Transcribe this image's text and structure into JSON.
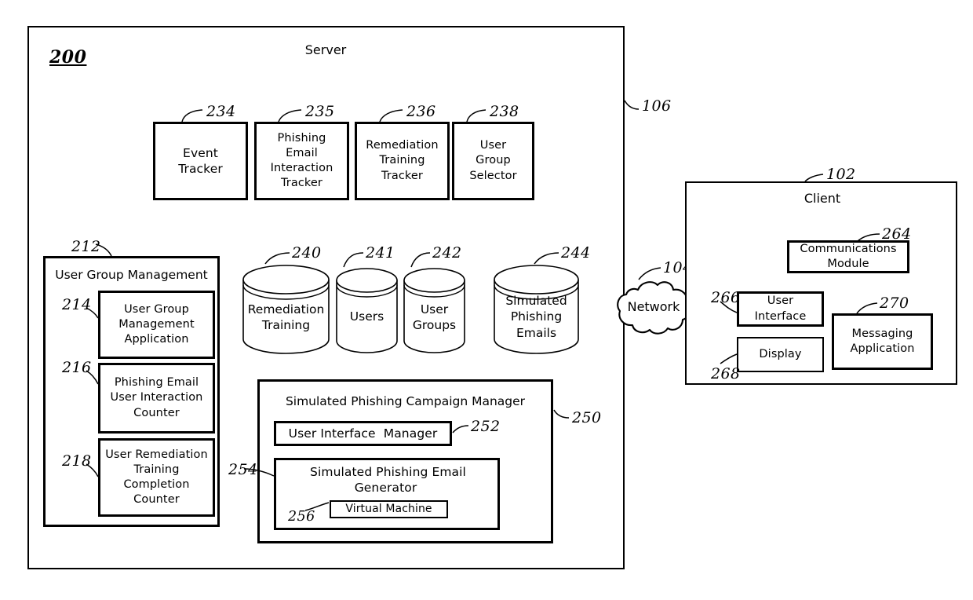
{
  "figure": {
    "number": "200",
    "domain_note": "patent block diagram"
  },
  "server": {
    "ref": "106",
    "title": "Server",
    "trackers": [
      {
        "ref": "234",
        "label": "Event\nTracker"
      },
      {
        "ref": "235",
        "label": "Phishing\nEmail\nInteraction\nTracker"
      },
      {
        "ref": "236",
        "label": "Remediation\nTraining\nTracker"
      },
      {
        "ref": "238",
        "label": "User\nGroup\nSelector"
      }
    ],
    "user_group_management": {
      "ref": "212",
      "title": "User Group Management",
      "items": [
        {
          "ref": "214",
          "label": "User Group\nManagement\nApplication"
        },
        {
          "ref": "216",
          "label": "Phishing Email\nUser Interaction\nCounter"
        },
        {
          "ref": "218",
          "label": "User Remediation\nTraining\nCompletion\nCounter"
        }
      ]
    },
    "databases": [
      {
        "ref": "240",
        "label": "Remediation\nTraining"
      },
      {
        "ref": "241",
        "label": "Users"
      },
      {
        "ref": "242",
        "label": "User\nGroups"
      },
      {
        "ref": "244",
        "label": "Simulated\nPhishing\nEmails"
      }
    ],
    "campaign_manager": {
      "ref": "250",
      "title": "Simulated Phishing Campaign Manager",
      "ui_manager": {
        "ref": "252",
        "label": "User Interface  Manager"
      },
      "email_generator": {
        "ref": "254",
        "label": "Simulated Phishing Email\nGenerator",
        "virtual_machine": {
          "ref": "256",
          "label": "Virtual Machine"
        }
      }
    }
  },
  "network": {
    "ref": "104",
    "label": "Network"
  },
  "client": {
    "ref": "102",
    "title": "Client",
    "modules": [
      {
        "ref": "264",
        "label": "Communications\nModule"
      },
      {
        "ref": "266",
        "label": "User\nInterface"
      },
      {
        "ref": "268",
        "label": "Display"
      },
      {
        "ref": "270",
        "label": "Messaging\nApplication"
      }
    ]
  },
  "colors": {
    "stroke": "#000000",
    "background": "#ffffff"
  }
}
